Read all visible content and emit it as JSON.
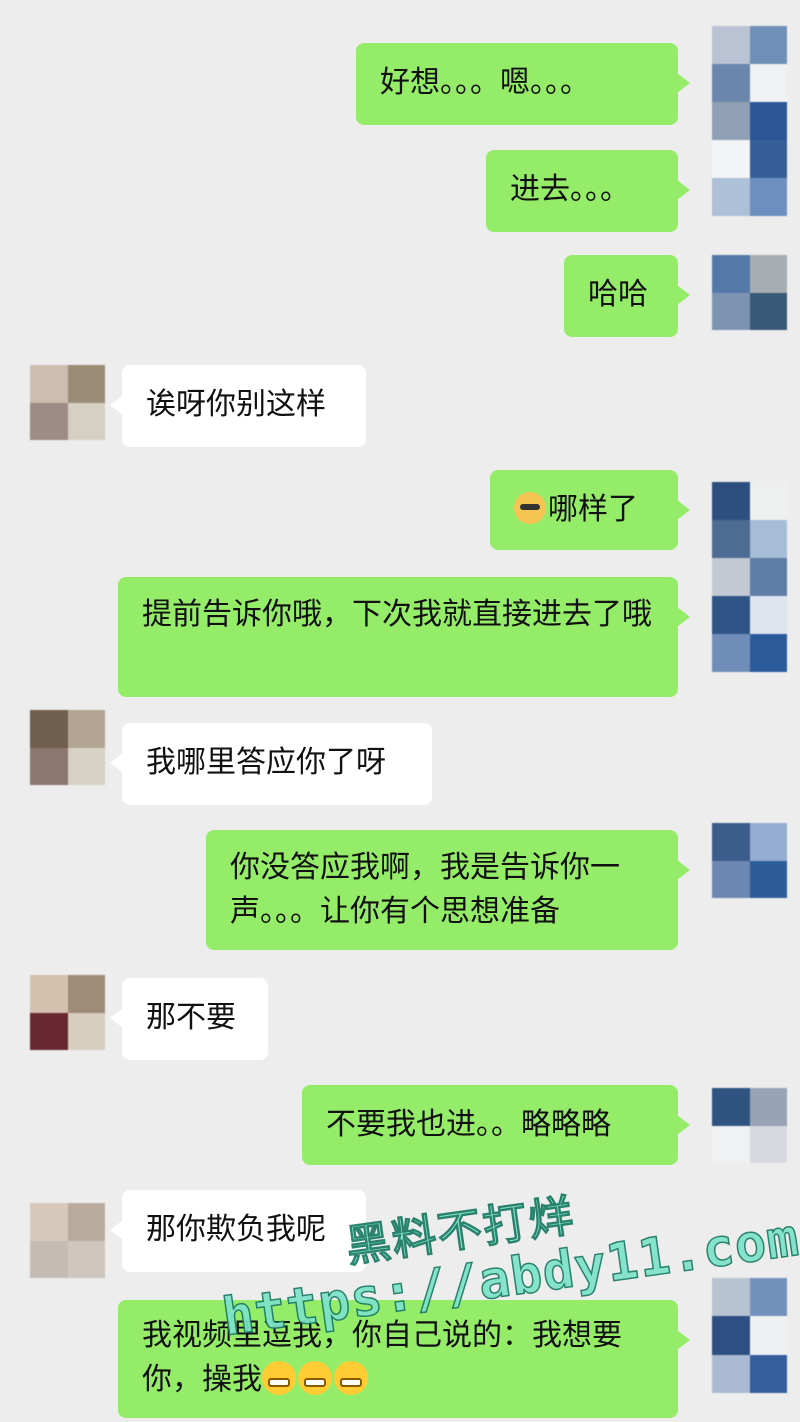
{
  "messages": [
    {
      "side": "me",
      "text": "好想。。。嗯。。。"
    },
    {
      "side": "me",
      "text": "进去。。。"
    },
    {
      "side": "me",
      "text": "哈哈"
    },
    {
      "side": "other",
      "text": "诶呀你别这样"
    },
    {
      "side": "me",
      "emoji": "doge-emoji",
      "text": "哪样了"
    },
    {
      "side": "me",
      "text": "提前告诉你哦，下次我就直接进去了哦"
    },
    {
      "side": "other",
      "text": "我哪里答应你了呀"
    },
    {
      "side": "me",
      "text": "你没答应我啊，我是告诉你一声。。。让你有个思想准备"
    },
    {
      "side": "other",
      "text": "那不要"
    },
    {
      "side": "me",
      "text": "不要我也进。。略略略"
    },
    {
      "side": "other",
      "text": "那你欺负我呢"
    },
    {
      "side": "me",
      "text": "我视频里逗我，你自己说的：我想要你，操我",
      "trailing_emoji": "grin-emoji",
      "trailing_count": 3
    }
  ],
  "watermark": {
    "line1": "黑料不打烊",
    "line2": "https://abdy11.com",
    "color": "#7ee3c9"
  },
  "colors": {
    "background": "#ededed",
    "my_bubble": "#95ec69",
    "other_bubble": "#ffffff"
  }
}
